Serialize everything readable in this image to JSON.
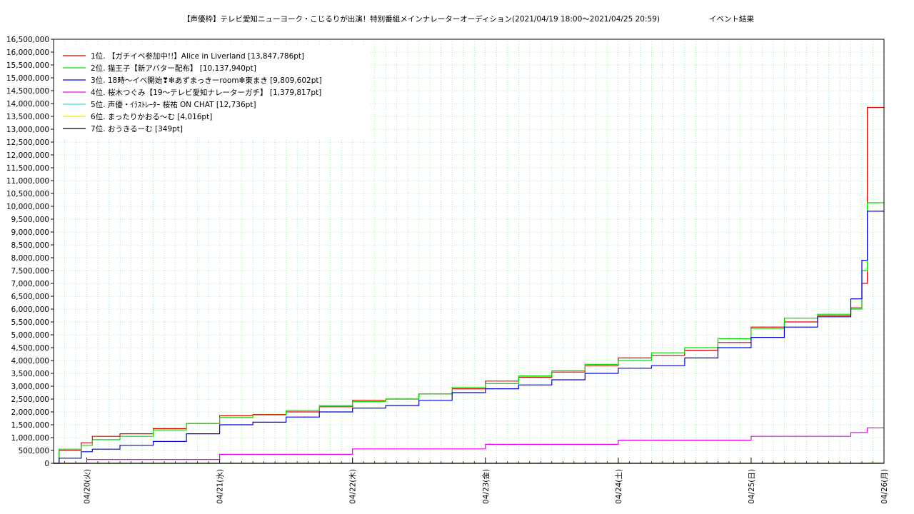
{
  "chart_data": {
    "type": "line",
    "title": "【声優枠】テレビ愛知ニューヨーク・こじるりが出演！特別番組メインナレーターオーディション(2021/04/19 18:00〜2021/04/25 20:59)",
    "subtitle": "イベント結果",
    "xlabel": "",
    "ylabel": "",
    "ylim": [
      0,
      16500000
    ],
    "x_range": [
      "2021-04-19 18:00",
      "2021-04-26 00:00"
    ],
    "grid": true,
    "legend_position": "top-left",
    "x_tick_labels": [
      "04/20(火)",
      "04/21(水)",
      "04/22(木)",
      "04/23(金)",
      "04/24(土)",
      "04/25(日)",
      "04/26(月)"
    ],
    "x_tick_values": [
      "2021-04-20 00:00",
      "2021-04-21 00:00",
      "2021-04-22 00:00",
      "2021-04-23 00:00",
      "2021-04-24 00:00",
      "2021-04-25 00:00",
      "2021-04-26 00:00"
    ],
    "y_tick_labels": [
      "0",
      "500,000",
      "1,000,000",
      "1,500,000",
      "2,000,000",
      "2,500,000",
      "3,000,000",
      "3,500,000",
      "4,000,000",
      "4,500,000",
      "5,000,000",
      "5,500,000",
      "6,000,000",
      "6,500,000",
      "7,000,000",
      "7,500,000",
      "8,000,000",
      "8,500,000",
      "9,000,000",
      "9,500,000",
      "10,000,000",
      "10,500,000",
      "11,000,000",
      "11,500,000",
      "12,000,000",
      "12,500,000",
      "13,000,000",
      "13,500,000",
      "14,000,000",
      "14,500,000",
      "15,000,000",
      "15,500,000",
      "16,000,000",
      "16,500,000"
    ],
    "series": [
      {
        "name": "1位. 【ガチイベ参加中!!】Alice in Liverland [13,847,786pt]",
        "color": "#e00000",
        "points": [
          [
            "2021-04-19 18:00",
            0
          ],
          [
            "2021-04-19 19:00",
            500000
          ],
          [
            "2021-04-19 23:00",
            800000
          ],
          [
            "2021-04-20 01:00",
            1050000
          ],
          [
            "2021-04-20 06:00",
            1150000
          ],
          [
            "2021-04-20 12:00",
            1350000
          ],
          [
            "2021-04-20 18:00",
            1550000
          ],
          [
            "2021-04-21 00:00",
            1850000
          ],
          [
            "2021-04-21 06:00",
            1900000
          ],
          [
            "2021-04-21 12:00",
            2000000
          ],
          [
            "2021-04-21 18:00",
            2200000
          ],
          [
            "2021-04-22 00:00",
            2450000
          ],
          [
            "2021-04-22 06:00",
            2500000
          ],
          [
            "2021-04-22 12:00",
            2700000
          ],
          [
            "2021-04-22 18:00",
            2900000
          ],
          [
            "2021-04-23 00:00",
            3200000
          ],
          [
            "2021-04-23 06:00",
            3350000
          ],
          [
            "2021-04-23 12:00",
            3550000
          ],
          [
            "2021-04-23 18:00",
            3800000
          ],
          [
            "2021-04-24 00:00",
            4100000
          ],
          [
            "2021-04-24 06:00",
            4200000
          ],
          [
            "2021-04-24 12:00",
            4400000
          ],
          [
            "2021-04-24 18:00",
            4700000
          ],
          [
            "2021-04-25 00:00",
            5300000
          ],
          [
            "2021-04-25 06:00",
            5500000
          ],
          [
            "2021-04-25 12:00",
            5750000
          ],
          [
            "2021-04-25 18:00",
            6050000
          ],
          [
            "2021-04-25 20:00",
            7000000
          ],
          [
            "2021-04-25 20:59",
            13847786
          ],
          [
            "2021-04-26 00:00",
            13847786
          ]
        ]
      },
      {
        "name": "2位. 猫王子【新アバター配布】 [10,137,940pt]",
        "color": "#00dd00",
        "points": [
          [
            "2021-04-19 18:00",
            0
          ],
          [
            "2021-04-19 19:00",
            550000
          ],
          [
            "2021-04-19 23:00",
            700000
          ],
          [
            "2021-04-20 01:00",
            920000
          ],
          [
            "2021-04-20 06:00",
            1050000
          ],
          [
            "2021-04-20 12:00",
            1300000
          ],
          [
            "2021-04-20 18:00",
            1550000
          ],
          [
            "2021-04-21 00:00",
            1780000
          ],
          [
            "2021-04-21 06:00",
            1880000
          ],
          [
            "2021-04-21 12:00",
            2050000
          ],
          [
            "2021-04-21 18:00",
            2250000
          ],
          [
            "2021-04-22 00:00",
            2400000
          ],
          [
            "2021-04-22 06:00",
            2500000
          ],
          [
            "2021-04-22 12:00",
            2700000
          ],
          [
            "2021-04-22 18:00",
            2950000
          ],
          [
            "2021-04-23 00:00",
            3100000
          ],
          [
            "2021-04-23 06:00",
            3400000
          ],
          [
            "2021-04-23 12:00",
            3600000
          ],
          [
            "2021-04-23 18:00",
            3850000
          ],
          [
            "2021-04-24 00:00",
            4000000
          ],
          [
            "2021-04-24 06:00",
            4300000
          ],
          [
            "2021-04-24 12:00",
            4500000
          ],
          [
            "2021-04-24 18:00",
            4850000
          ],
          [
            "2021-04-25 00:00",
            5250000
          ],
          [
            "2021-04-25 06:00",
            5650000
          ],
          [
            "2021-04-25 12:00",
            5800000
          ],
          [
            "2021-04-25 18:00",
            6000000
          ],
          [
            "2021-04-25 20:00",
            7500000
          ],
          [
            "2021-04-25 20:59",
            10137940
          ],
          [
            "2021-04-26 00:00",
            10137940
          ]
        ]
      },
      {
        "name": "3位. 18時〜イベ開始❣❇あずまっきーroom❇東まき [9,809,602pt]",
        "color": "#0000dd",
        "points": [
          [
            "2021-04-19 18:00",
            0
          ],
          [
            "2021-04-19 19:00",
            200000
          ],
          [
            "2021-04-19 23:00",
            450000
          ],
          [
            "2021-04-20 01:00",
            550000
          ],
          [
            "2021-04-20 06:00",
            700000
          ],
          [
            "2021-04-20 12:00",
            850000
          ],
          [
            "2021-04-20 18:00",
            1150000
          ],
          [
            "2021-04-21 00:00",
            1500000
          ],
          [
            "2021-04-21 06:00",
            1600000
          ],
          [
            "2021-04-21 12:00",
            1800000
          ],
          [
            "2021-04-21 18:00",
            2000000
          ],
          [
            "2021-04-22 00:00",
            2150000
          ],
          [
            "2021-04-22 06:00",
            2250000
          ],
          [
            "2021-04-22 12:00",
            2450000
          ],
          [
            "2021-04-22 18:00",
            2750000
          ],
          [
            "2021-04-23 00:00",
            2900000
          ],
          [
            "2021-04-23 06:00",
            3050000
          ],
          [
            "2021-04-23 12:00",
            3250000
          ],
          [
            "2021-04-23 18:00",
            3500000
          ],
          [
            "2021-04-24 00:00",
            3700000
          ],
          [
            "2021-04-24 06:00",
            3800000
          ],
          [
            "2021-04-24 12:00",
            4100000
          ],
          [
            "2021-04-24 18:00",
            4500000
          ],
          [
            "2021-04-25 00:00",
            4900000
          ],
          [
            "2021-04-25 06:00",
            5300000
          ],
          [
            "2021-04-25 12:00",
            5700000
          ],
          [
            "2021-04-25 18:00",
            6400000
          ],
          [
            "2021-04-25 20:00",
            7900000
          ],
          [
            "2021-04-25 20:59",
            9809602
          ],
          [
            "2021-04-26 00:00",
            9809602
          ]
        ]
      },
      {
        "name": "4位. 桜木つぐみ【19〜テレビ愛知ナレーターガチ】 [1,379,817pt]",
        "color": "#ee00ee",
        "points": [
          [
            "2021-04-19 18:00",
            0
          ],
          [
            "2021-04-20 00:00",
            150000
          ],
          [
            "2021-04-21 00:00",
            350000
          ],
          [
            "2021-04-22 00:00",
            560000
          ],
          [
            "2021-04-23 00:00",
            740000
          ],
          [
            "2021-04-24 00:00",
            900000
          ],
          [
            "2021-04-25 00:00",
            1050000
          ],
          [
            "2021-04-25 18:00",
            1200000
          ],
          [
            "2021-04-25 20:59",
            1379817
          ],
          [
            "2021-04-26 00:00",
            1379817
          ]
        ]
      },
      {
        "name": "5位. 声優・ｲﾗｽﾄﾚｰﾀｰ 桜祐 ON CHAT [12,736pt]",
        "color": "#33dddd",
        "points": [
          [
            "2021-04-19 18:00",
            0
          ],
          [
            "2021-04-25 20:59",
            12736
          ],
          [
            "2021-04-26 00:00",
            12736
          ]
        ]
      },
      {
        "name": "6位. まったりかおる〜む [4,016pt]",
        "color": "#eeee00",
        "points": [
          [
            "2021-04-19 18:00",
            0
          ],
          [
            "2021-04-25 20:59",
            4016
          ],
          [
            "2021-04-26 00:00",
            4016
          ]
        ]
      },
      {
        "name": "7位. おうきるーむ [349pt]",
        "color": "#000000",
        "points": [
          [
            "2021-04-19 18:00",
            0
          ],
          [
            "2021-04-25 20:59",
            349
          ],
          [
            "2021-04-26 00:00",
            349
          ]
        ]
      }
    ]
  }
}
